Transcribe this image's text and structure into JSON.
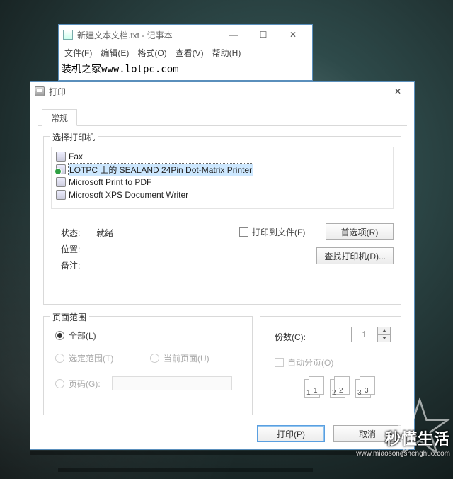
{
  "watermark": {
    "cn": "秒懂生活",
    "en": "www.miaosongshenghuo.com"
  },
  "notepad": {
    "title": "新建文本文档.txt - 记事本",
    "menus": {
      "file": "文件(F)",
      "edit": "编辑(E)",
      "format": "格式(O)",
      "view": "查看(V)",
      "help": "帮助(H)"
    },
    "content_line": "装机之家www.lotpc.com"
  },
  "dialog": {
    "title": "打印",
    "tab_general": "常规",
    "group_printer_label": "选择打印机",
    "printers": {
      "p0": "Fax",
      "p1": "LOTPC 上的 SEALAND 24Pin Dot-Matrix Printer",
      "p2": "Microsoft Print to PDF",
      "p3": "Microsoft XPS Document Writer"
    },
    "status_label": "状态:",
    "status_value": "就绪",
    "location_label": "位置:",
    "remark_label": "备注:",
    "print_to_file": "打印到文件(F)",
    "btn_pref": "首选项(R)",
    "btn_find": "查找打印机(D)...",
    "group_range_label": "页面范围",
    "range": {
      "all": "全部(L)",
      "selection": "选定范围(T)",
      "current": "当前页面(U)",
      "pages": "页码(G):"
    },
    "copies_label": "份数(C):",
    "copies_value": "1",
    "collate": "自动分页(O)",
    "btn_print": "打印(P)",
    "btn_cancel": "取消"
  }
}
